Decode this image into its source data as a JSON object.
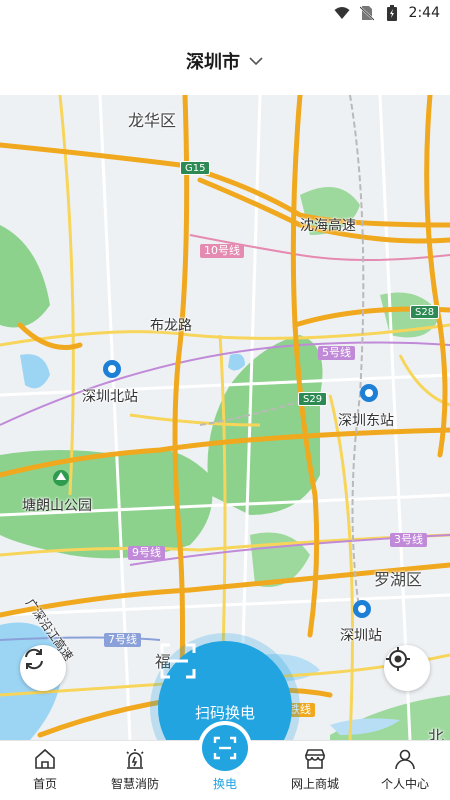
{
  "status_bar": {
    "time": "2:44"
  },
  "header": {
    "city": "深圳市"
  },
  "map": {
    "labels": {
      "longhua": "龙华区",
      "shenhai": "沈海高速",
      "line10": "10号线",
      "bulong": "布龙路",
      "line5": "5号线",
      "shenzhen_north": "深圳北站",
      "shenzhen_east": "深圳东站",
      "tanglang": "塘朗山公园",
      "line9": "9号线",
      "line3": "3号线",
      "luohu": "罗湖区",
      "shenzhen_station": "深圳站",
      "line7": "7号线",
      "futian": "福",
      "guangshen": "广深沿江高速",
      "dongtie": "东铁线",
      "bei": "北",
      "g15": "G15",
      "s28": "S28",
      "s29": "S29"
    }
  },
  "scan_button": {
    "label": "扫码换电"
  },
  "tabbar": {
    "tabs": [
      {
        "label": "首页"
      },
      {
        "label": "智慧消防"
      },
      {
        "label": "换电"
      },
      {
        "label": "网上商城"
      },
      {
        "label": "个人中心"
      }
    ],
    "active_index": 2
  },
  "colors": {
    "accent": "#22a4e0",
    "highway": "#f0a81e",
    "park": "#8cd28c",
    "water": "#9cd4f4"
  }
}
